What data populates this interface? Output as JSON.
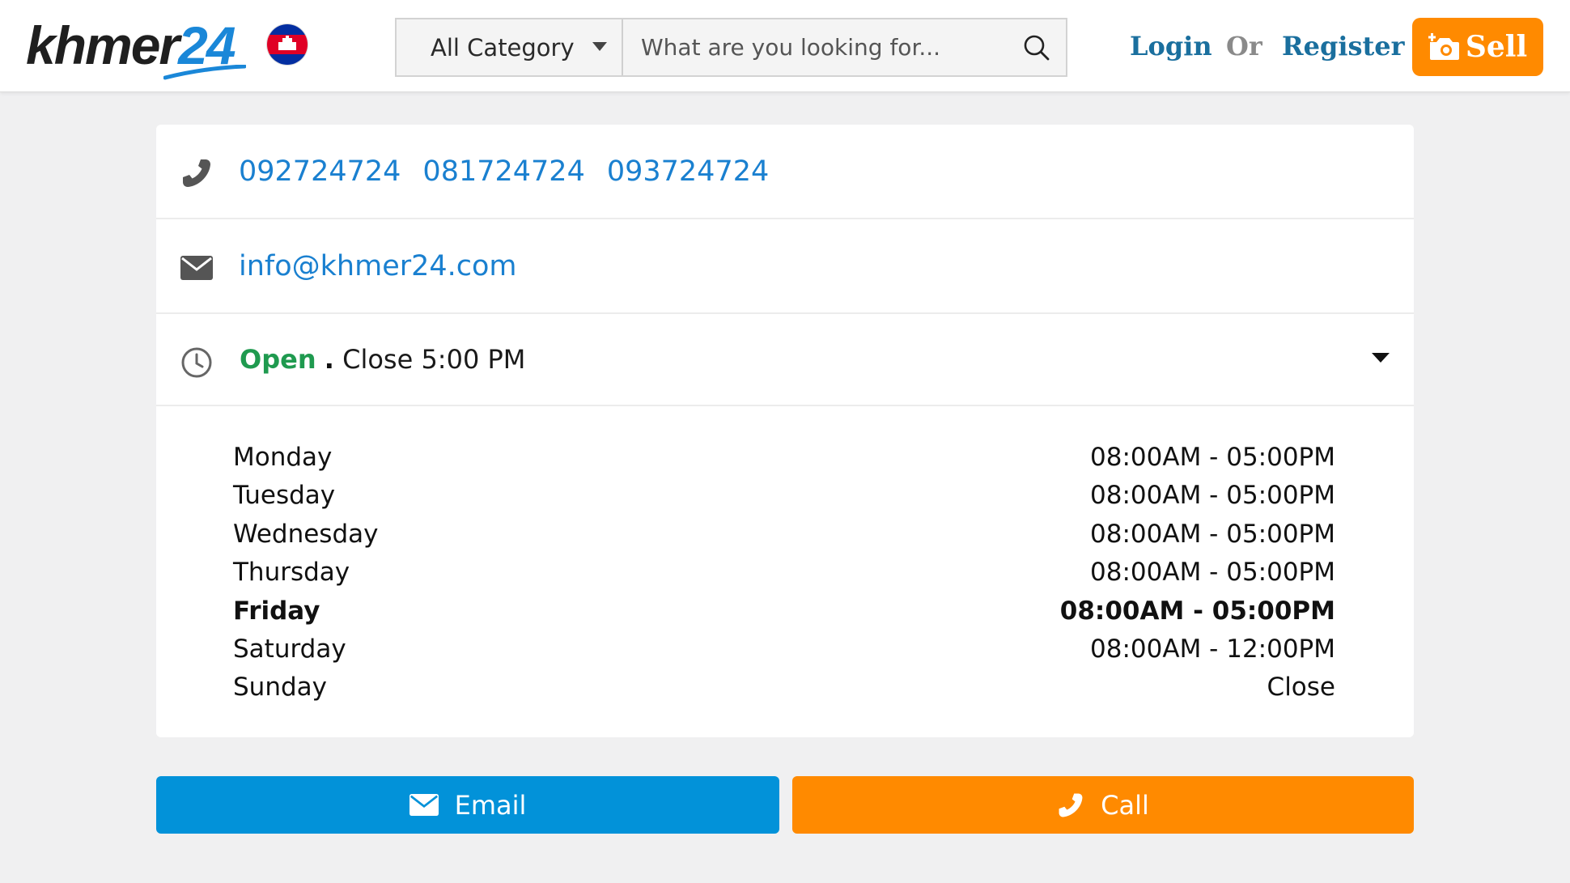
{
  "header": {
    "logo": {
      "text_main": "khmer",
      "text_num": "24",
      "brand_color": "#1a87d8"
    },
    "flag_icon": "cambodia-flag-icon",
    "category": {
      "selected": "All Category"
    },
    "search": {
      "placeholder": "What are you looking for...",
      "icon": "search-icon"
    },
    "login_label": "Login",
    "or_label": "Or",
    "register_label": "Register",
    "sell": {
      "label": "Sell",
      "icon": "camera-plus-icon",
      "color": "#ff8a00"
    }
  },
  "contact": {
    "phone_icon": "phone-icon",
    "phones": [
      "092724724",
      "081724724",
      "093724724"
    ],
    "email_icon": "envelope-icon",
    "email": "info@khmer24.com",
    "hours": {
      "icon": "clock-icon",
      "status_open": "Open",
      "status_separator": ".",
      "status_close": "Close 5:00 PM",
      "status_color": "#1f9a4f",
      "schedule": [
        {
          "day": "Monday",
          "time": "08:00AM - 05:00PM"
        },
        {
          "day": "Tuesday",
          "time": "08:00AM - 05:00PM"
        },
        {
          "day": "Wednesday",
          "time": "08:00AM - 05:00PM"
        },
        {
          "day": "Thursday",
          "time": "08:00AM - 05:00PM"
        },
        {
          "day": "Friday",
          "time": "08:00AM - 05:00PM",
          "highlighted": true
        },
        {
          "day": "Saturday",
          "time": "08:00AM - 12:00PM"
        },
        {
          "day": "Sunday",
          "time": "Close"
        }
      ]
    }
  },
  "actions": {
    "email": {
      "label": "Email",
      "icon": "envelope-icon",
      "color": "#0292d9"
    },
    "call": {
      "label": "Call",
      "icon": "phone-icon",
      "color": "#ff8a00"
    }
  }
}
